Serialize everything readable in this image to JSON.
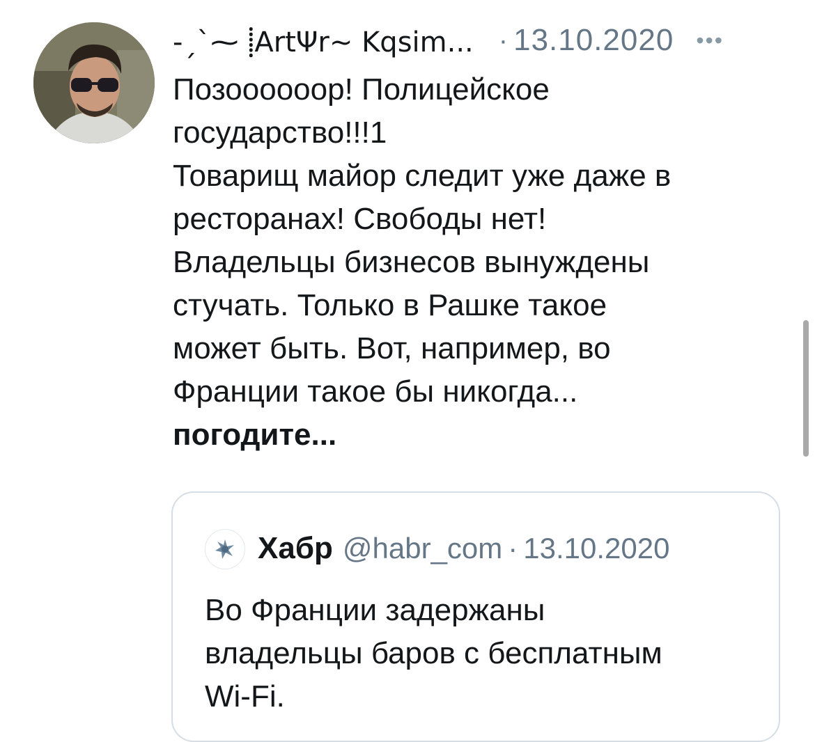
{
  "tweet": {
    "display_name": "-ˏˋ⁓ ⸽ArtΨr~ Kqsim...",
    "date_separator": "·",
    "date": "13.10.2020",
    "more_icon": "more-options-icon",
    "more_label": "•••",
    "text_lines": [
      "Позоооооор! Полицейское",
      "государство!!!1",
      "Товарищ майор следит уже даже в",
      "ресторанах! Свободы нет!",
      "Владельцы бизнесов вынуждены",
      "стучать. Только в Рашке такое",
      "может быть. Вот, например, во",
      "Франции такое бы никогда...",
      "погодите..."
    ]
  },
  "quoted_tweet": {
    "name": "Хабр",
    "handle": "@habr_com",
    "separator": "·",
    "date": "13.10.2020",
    "text_lines": [
      "Во Франции задержаны",
      "владельцы баров с бесплатным",
      "Wi-Fi."
    ]
  },
  "colors": {
    "text": "#14171a",
    "secondary": "#657786",
    "border": "#d6dde3"
  }
}
